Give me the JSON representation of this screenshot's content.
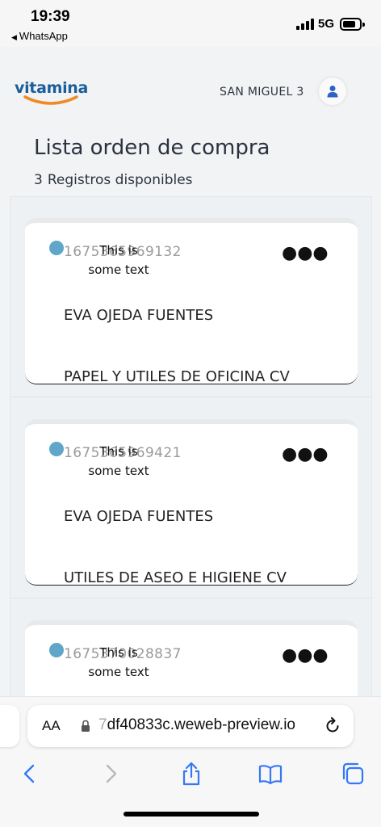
{
  "status_bar": {
    "time": "19:39",
    "back_app": "WhatsApp",
    "network": "5G",
    "battery_percent": 80
  },
  "header": {
    "logo_text": "vitamina",
    "location": "SAN MIGUEL 3",
    "user_icon": "user-icon"
  },
  "page": {
    "title": "Lista orden de compra",
    "records_count": "3",
    "records_label": "Registros disponibles"
  },
  "orders": [
    {
      "id": "1675365969132",
      "overlay": "This is some text",
      "name": "EVA OJEDA FUENTES",
      "category": "PAPEL Y UTILES DE OFICINA CV"
    },
    {
      "id": "1675365969421",
      "overlay": "This is some text",
      "name": "EVA OJEDA FUENTES",
      "category": "UTILES DE ASEO E HIGIENE CV"
    },
    {
      "id": "1675370028837",
      "overlay": "This is some text",
      "name": "",
      "category": ""
    }
  ],
  "browser": {
    "aa_label": "AA",
    "url": "df40833c.weweb-preview.io",
    "url_prefix_faded": "7"
  },
  "colors": {
    "brand_blue": "#1a5e9a",
    "brand_orange": "#f08a24",
    "status_dot": "#5fa6c8",
    "ios_blue": "#3478f6"
  }
}
